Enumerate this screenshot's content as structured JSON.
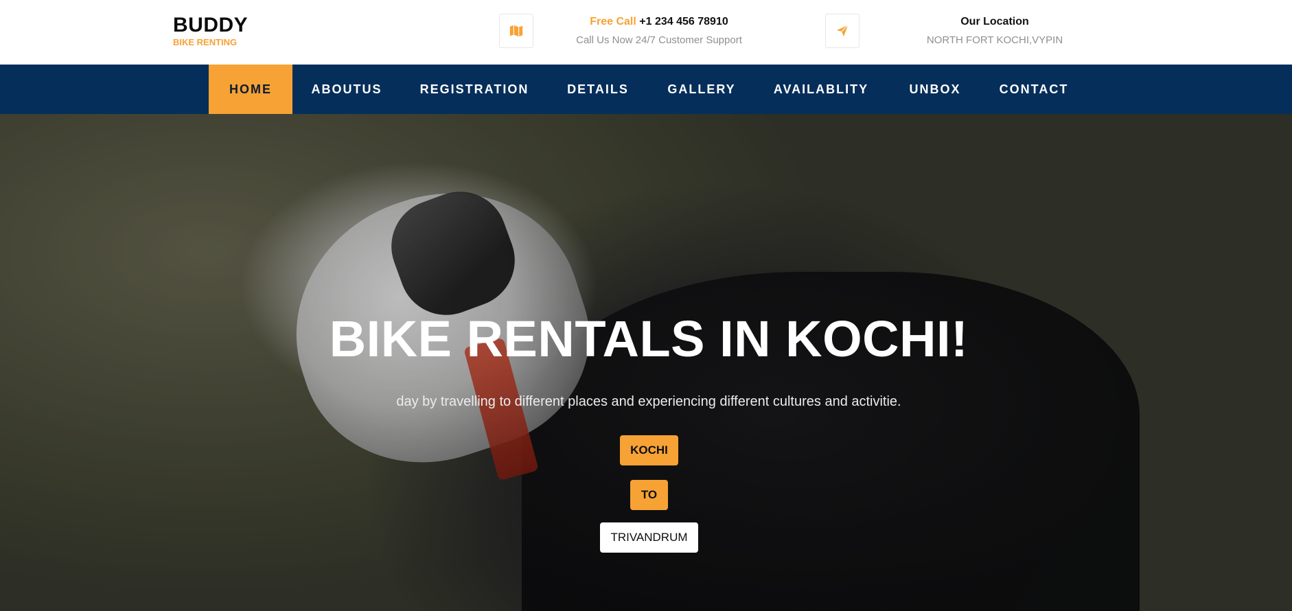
{
  "brand": {
    "name": "BUDDY",
    "tagline": "BIKE RENTING"
  },
  "contact": {
    "icon": "map-icon",
    "label_accent": "Free Call",
    "phone": "+1 234 456 78910",
    "note": "Call Us Now 24/7 Customer Support"
  },
  "location": {
    "icon": "send-icon",
    "title": "Our Location",
    "address": "NORTH FORT KOCHI,VYPIN"
  },
  "nav": {
    "items": [
      {
        "label": "HOME",
        "active": true
      },
      {
        "label": "ABOUTUS",
        "active": false
      },
      {
        "label": "REGISTRATION",
        "active": false
      },
      {
        "label": "DETAILS",
        "active": false
      },
      {
        "label": "GALLERY",
        "active": false
      },
      {
        "label": "AVAILABLITY",
        "active": false
      },
      {
        "label": "UNBOX",
        "active": false
      },
      {
        "label": "CONTACT",
        "active": false
      }
    ]
  },
  "hero": {
    "title": "BIKE RENTALS IN KOCHI!",
    "subtitle": "day by travelling to different places and experiencing different cultures and activitie.",
    "buttons": [
      {
        "label": "KOCHI"
      },
      {
        "label": "TO"
      },
      {
        "label": "TRIVANDRUM"
      }
    ]
  },
  "colors": {
    "accent": "#f7a234",
    "nav_bg": "#062e5a"
  }
}
